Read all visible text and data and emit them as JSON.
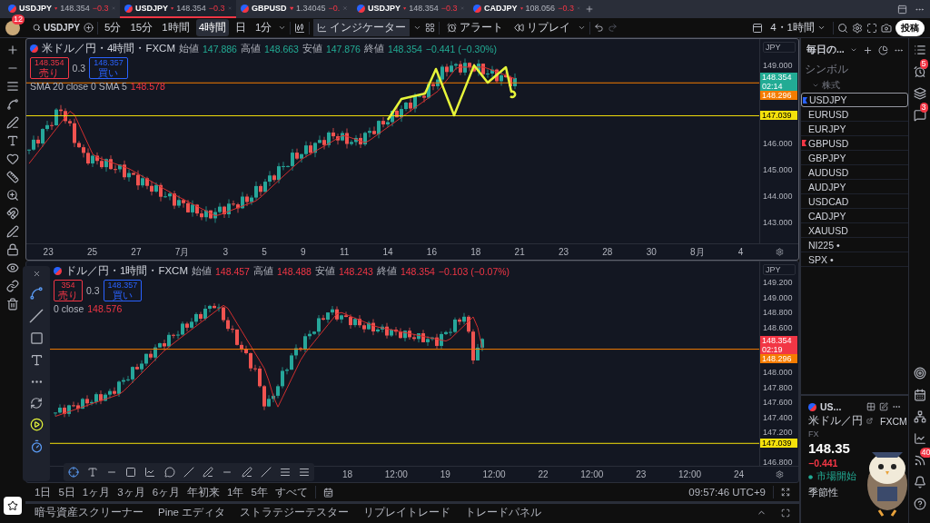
{
  "tabs": [
    {
      "symbol": "USDJPY",
      "price": "148.354",
      "change": "−0.3",
      "selected": false
    },
    {
      "symbol": "USDJPY",
      "price": "148.354",
      "change": "−0.3",
      "selected": true
    },
    {
      "symbol": "GBPUSD",
      "price": "1.34045",
      "change": "−0.",
      "selected": false
    },
    {
      "symbol": "USDJPY",
      "price": "148.354",
      "change": "−0.3",
      "selected": false
    },
    {
      "symbol": "CADJPY",
      "price": "108.056",
      "change": "−0.3",
      "selected": false
    }
  ],
  "toolbar": {
    "avatar_badge": "12",
    "symbol": "USDJPY",
    "intervals": [
      {
        "label": "5分",
        "selected": false
      },
      {
        "label": "15分",
        "selected": false
      },
      {
        "label": "1時間",
        "selected": false
      },
      {
        "label": "4時間",
        "selected": true
      },
      {
        "label": "日",
        "selected": false
      },
      {
        "label": "1分",
        "selected": false
      }
    ],
    "indicators": "インジケーター",
    "alerts": "アラート",
    "replay": "リプレイ",
    "layout": "4・1時間",
    "publish": "投稿"
  },
  "charts": [
    {
      "title": "米ドル／円・4時間・FXCM",
      "rising": true,
      "ohlc": [
        {
          "label": "始値",
          "value": "147.886"
        },
        {
          "label": "高値",
          "value": "148.663"
        },
        {
          "label": "安値",
          "value": "147.876"
        },
        {
          "label": "終値",
          "value": "148.354"
        }
      ],
      "change": "−0.441 (−0.30%)",
      "sell": {
        "price": "148.354",
        "label": "売り"
      },
      "spread": "0.3",
      "buy": {
        "price": "148.357",
        "label": "買い"
      },
      "sma": "SMA 20 close 0 SMA 5",
      "sma_value": "148.578",
      "currency": "JPY",
      "price_ticks": [
        "149.000",
        "146.000",
        "145.000",
        "144.000",
        "143.000"
      ],
      "price_tags": [
        {
          "value": "148.354",
          "sub": "02:14",
          "color": "#22ab94"
        },
        {
          "value": "148.296",
          "color": "#f57c00"
        },
        {
          "value": "147.039",
          "color": "#f5e10b"
        }
      ],
      "time_ticks": [
        "23",
        "25",
        "27",
        "7月",
        "3",
        "5",
        "9",
        "11",
        "14",
        "16",
        "18",
        "21",
        "23",
        "28",
        "30",
        "8月",
        "4"
      ]
    },
    {
      "title": "ドル／円・1時間・FXCM",
      "rising": false,
      "ohlc": [
        {
          "label": "始値",
          "value": "148.457"
        },
        {
          "label": "高値",
          "value": "148.488"
        },
        {
          "label": "安値",
          "value": "148.243"
        },
        {
          "label": "終値",
          "value": "148.354"
        }
      ],
      "change": "−0.103 (−0.07%)",
      "sell": {
        "price": "354",
        "label": "売り"
      },
      "spread": "0.3",
      "buy": {
        "price": "148.357",
        "label": "買い"
      },
      "sma": "0 close",
      "sma_value": "148.576",
      "currency": "JPY",
      "price_ticks": [
        "149.200",
        "149.000",
        "148.800",
        "148.600",
        "148.000",
        "147.800",
        "147.600",
        "147.400",
        "147.200",
        "146.800"
      ],
      "price_tags": [
        {
          "value": "148.354",
          "sub": "02:19",
          "color": "#f23645"
        },
        {
          "value": "148.296",
          "color": "#f57c00"
        },
        {
          "value": "147.039",
          "color": "#f5e10b"
        }
      ],
      "time_ticks": [
        "18",
        "12:00",
        "19",
        "12:00",
        "22",
        "12:00",
        "23",
        "12:00",
        "24"
      ]
    }
  ],
  "range_bar": {
    "ranges": [
      "1日",
      "5日",
      "1ヶ月",
      "3ヶ月",
      "6ヶ月",
      "年初来",
      "1年",
      "5年",
      "すべて"
    ],
    "clock": "09:57:46 UTC+9"
  },
  "bottom_tabs": [
    "暗号資産スクリーナー",
    "Pine エディタ",
    "ストラテジーテスター",
    "リプレイトレード",
    "トレードパネル"
  ],
  "watchlist": {
    "title": "毎日の...",
    "column": "シンボル",
    "section": {
      "label": "株式",
      "expanded": true
    },
    "items": [
      {
        "symbol": "USDJPY",
        "selected": true,
        "color": "#2962ff"
      },
      {
        "symbol": "EURUSD",
        "selected": false
      },
      {
        "symbol": "EURJPY",
        "selected": false
      },
      {
        "symbol": "GBPUSD",
        "selected": false,
        "color": "#f23645"
      },
      {
        "symbol": "GBPJPY",
        "selected": false
      },
      {
        "symbol": "AUDUSD",
        "selected": false
      },
      {
        "symbol": "AUDJPY",
        "selected": false
      },
      {
        "symbol": "USDCAD",
        "selected": false
      },
      {
        "symbol": "CADJPY",
        "selected": false
      },
      {
        "symbol": "XAUUSD",
        "selected": false
      },
      {
        "symbol": "NI225 •",
        "selected": false
      },
      {
        "symbol": "SPX •",
        "selected": false
      }
    ]
  },
  "details": {
    "symbol": "US...",
    "name": "米ドル／円",
    "exchange": "FXCM",
    "type": "FX",
    "price": "148.35",
    "change": "−0.441",
    "status": "市場開始",
    "section": "季節性"
  },
  "side_badges": {
    "alerts": "5",
    "chat": "3",
    "feed": "40"
  }
}
